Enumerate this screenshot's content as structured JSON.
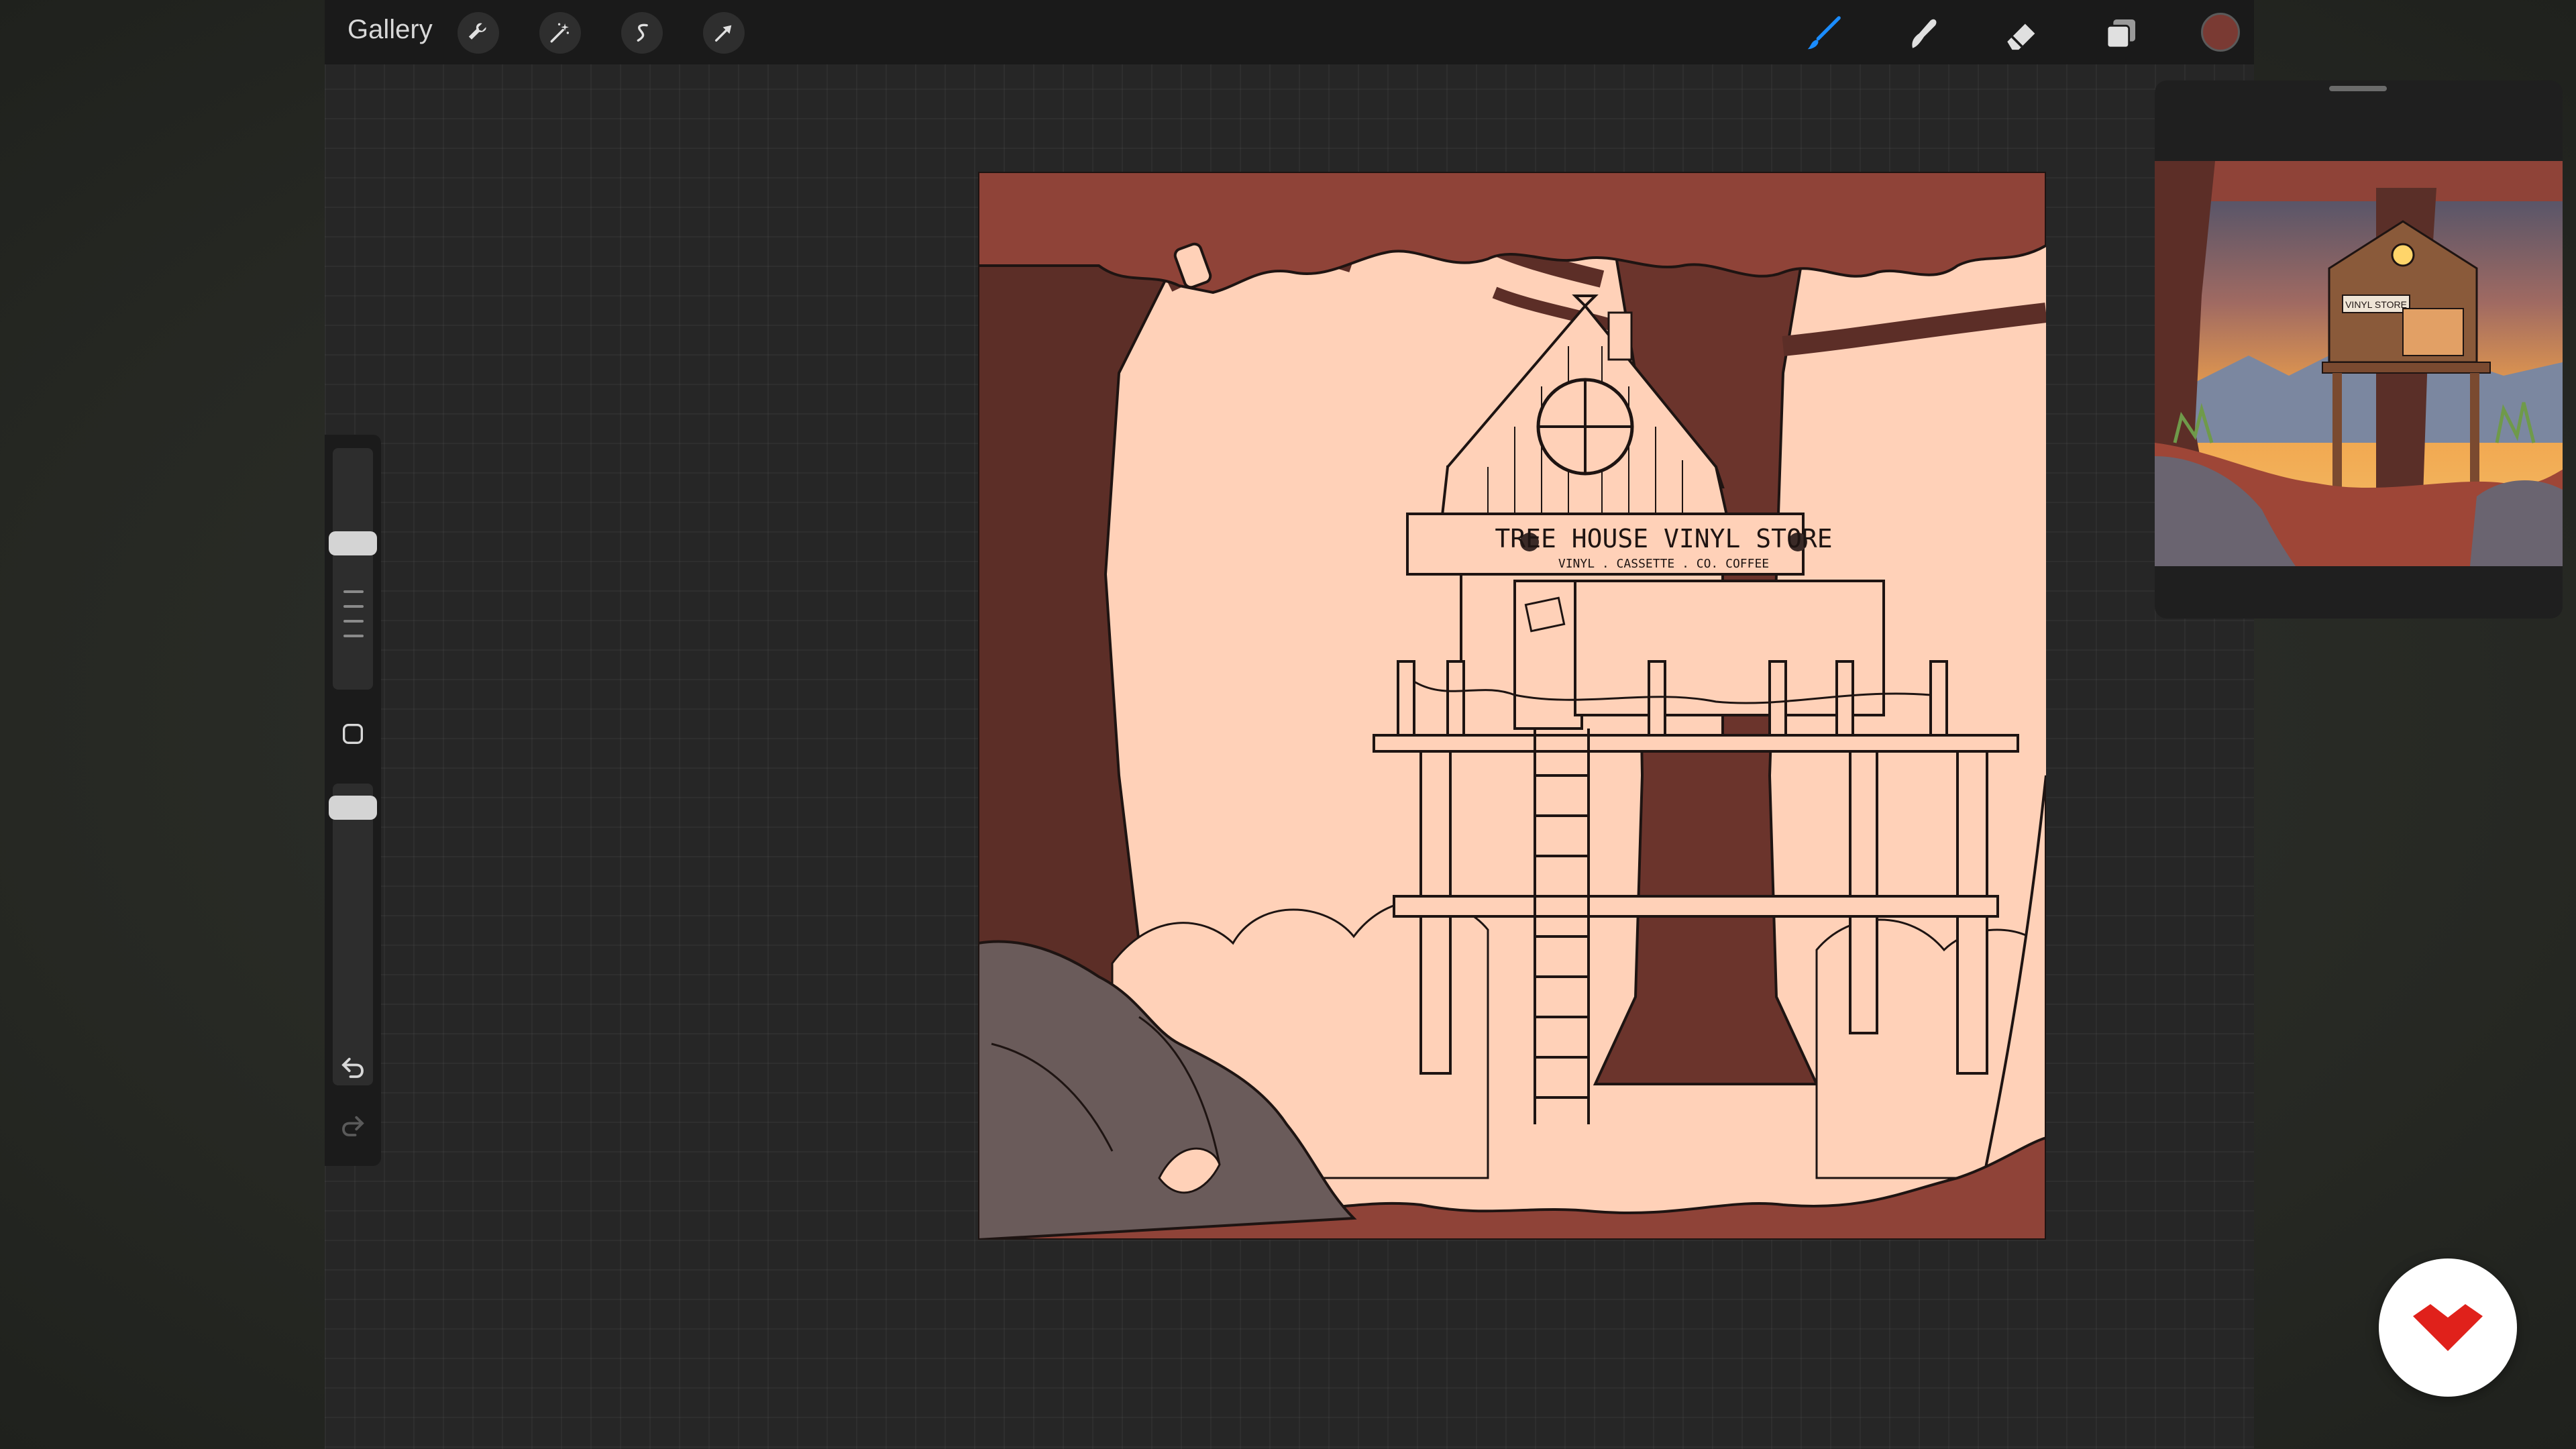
{
  "toolbar": {
    "gallery_label": "Gallery",
    "left_icons": [
      "wrench-icon",
      "magic-wand-icon",
      "selection-s-icon",
      "transform-arrow-icon"
    ],
    "right_icons": [
      "brush-icon",
      "smudge-icon",
      "eraser-icon",
      "layers-icon"
    ],
    "active_tool": "brush-icon",
    "current_color": "#7a3a33"
  },
  "canvas": {
    "sign_title": "TREE HOUSE VINYL STORE",
    "sign_subtitle": "VINYL . CASSETTE . CO. COFFEE"
  },
  "reference": {
    "thumb_sign": "VINYL STORE"
  },
  "colors": {
    "accent_blue": "#1a8cff",
    "canvas_bg": "#ffd1b8",
    "tree_dark": "#5a2f28",
    "foliage": "#8f4338",
    "rock": "#6a5b5a"
  },
  "brand": {
    "logo_icon": "domestika-heart-icon"
  }
}
